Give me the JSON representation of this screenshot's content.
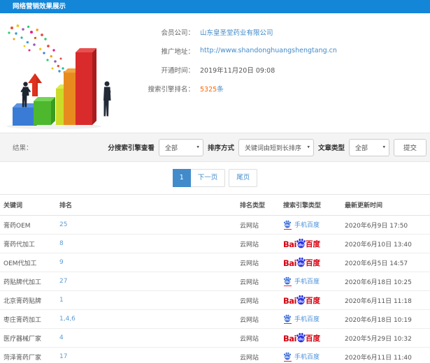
{
  "header": {
    "title": "网络营销效果展示"
  },
  "info": {
    "member_label": "会员公司：",
    "member_value": "山东皇圣堂药业有限公司",
    "url_label": "推广地址：",
    "url_value": "http://www.shandonghuangshengtang.cn",
    "opened_label": "开通时间：",
    "opened_value": "2019年11月20日 09:08",
    "rank_label": "搜索引擎排名：",
    "rank_count": "5325",
    "rank_unit": "条"
  },
  "filters": {
    "result_label": "结果：",
    "engine_view_label": "分搜索引擎查看",
    "engine_view_value": "全部",
    "sort_label": "排序方式",
    "sort_value": "关键词由短到长排序",
    "article_type_label": "文章类型",
    "article_type_value": "全部",
    "submit_label": "提交"
  },
  "pagination": {
    "current": "1",
    "next_label": "下一页",
    "last_label": "尾页"
  },
  "table": {
    "headers": [
      "关键词",
      "排名",
      "排名类型",
      "搜索引擎类型",
      "最新更新时间"
    ],
    "rows": [
      {
        "keyword": "膏药OEM",
        "rank": "25",
        "rank_type": "云网站",
        "engine": "mobile-baidu",
        "updated": "2020年6月9日 17:50"
      },
      {
        "keyword": "膏药代加工",
        "rank": "8",
        "rank_type": "云网站",
        "engine": "baidu",
        "updated": "2020年6月10日 13:40"
      },
      {
        "keyword": "OEM代加工",
        "rank": "9",
        "rank_type": "云网站",
        "engine": "baidu",
        "updated": "2020年6月5日 14:57"
      },
      {
        "keyword": "药贴牌代加工",
        "rank": "27",
        "rank_type": "云网站",
        "engine": "mobile-baidu",
        "updated": "2020年6月18日 10:25"
      },
      {
        "keyword": "北京膏药贴牌",
        "rank": "1",
        "rank_type": "云网站",
        "engine": "baidu",
        "updated": "2020年6月11日 11:18"
      },
      {
        "keyword": "枣庄膏药加工",
        "rank": "1,4,6",
        "rank_type": "云网站",
        "engine": "mobile-baidu",
        "updated": "2020年6月18日 10:19"
      },
      {
        "keyword": "医疗器械厂家",
        "rank": "4",
        "rank_type": "云网站",
        "engine": "baidu",
        "updated": "2020年5月29日 10:32"
      },
      {
        "keyword": "菏泽膏药厂家",
        "rank": "17",
        "rank_type": "云网站",
        "engine": "mobile-baidu",
        "updated": "2020年6月11日 11:40"
      }
    ]
  },
  "engine_logos": {
    "mobile_label": "手机百度",
    "baidu_bai": "Bai",
    "baidu_du": "du",
    "baidu_cn": "百度"
  },
  "colors": {
    "header_bg": "#1486d8",
    "link": "#428bca",
    "rank_link": "#5b9cd6",
    "count_orange": "#ff6600",
    "baidu_red": "#d7000f",
    "baidu_blue": "#2932e1",
    "mobile_blue": "#3a6ed8",
    "pagination_active": "#428bca"
  }
}
